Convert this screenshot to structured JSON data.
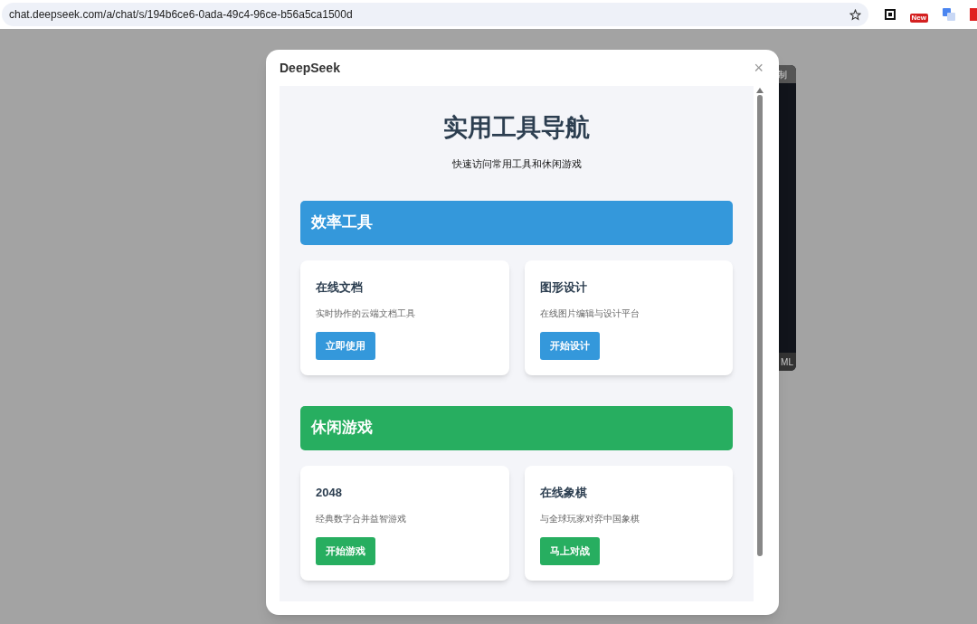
{
  "browser": {
    "url": "chat.deepseek.com/a/chat/s/194b6ce6-0ada-49c4-96ce-b56a5ca1500d",
    "extension_badge": "New"
  },
  "background_panel": {
    "header_text": "制",
    "footer_text": "ML"
  },
  "modal": {
    "title": "DeepSeek",
    "close": "×"
  },
  "page": {
    "title": "实用工具导航",
    "subtitle": "快速访问常用工具和休闲游戏",
    "sections": [
      {
        "title": "效率工具",
        "color": "#3498db",
        "cards": [
          {
            "title": "在线文档",
            "description": "实时协作的云端文档工具",
            "button": "立即使用"
          },
          {
            "title": "图形设计",
            "description": "在线图片编辑与设计平台",
            "button": "开始设计"
          }
        ]
      },
      {
        "title": "休闲游戏",
        "color": "#27ae60",
        "cards": [
          {
            "title": "2048",
            "description": "经典数字合并益智游戏",
            "button": "开始游戏"
          },
          {
            "title": "在线象棋",
            "description": "与全球玩家对弈中国象棋",
            "button": "马上对战"
          }
        ]
      }
    ]
  }
}
